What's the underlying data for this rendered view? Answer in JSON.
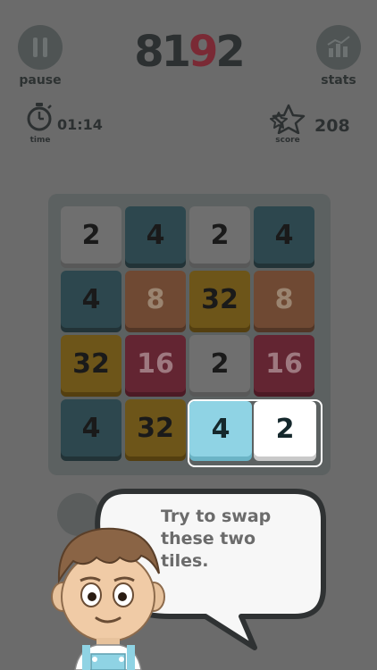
{
  "header": {
    "pause_label": "pause",
    "stats_label": "stats",
    "title_a": "81",
    "title_b": "9",
    "title_c": "2"
  },
  "status": {
    "time_value": "01:14",
    "time_label": "time",
    "score_value": "208",
    "score_label": "score"
  },
  "board": {
    "rows": [
      [
        "2",
        "4",
        "2",
        "4"
      ],
      [
        "4",
        "8",
        "32",
        "8"
      ],
      [
        "32",
        "16",
        "2",
        "16"
      ],
      [
        "4",
        "32",
        "4",
        "2"
      ]
    ],
    "highlighted_tiles": "row 4, columns 3 and 4"
  },
  "tutorial": {
    "line1": "Try to swap",
    "line2": "these two",
    "line3": "tiles."
  },
  "colors": {
    "overlay_bg": "#6b6b6b",
    "highlight_blue": "#8fd3e4",
    "highlight_white": "#ffffff",
    "title_accent": "#7a2a35"
  }
}
